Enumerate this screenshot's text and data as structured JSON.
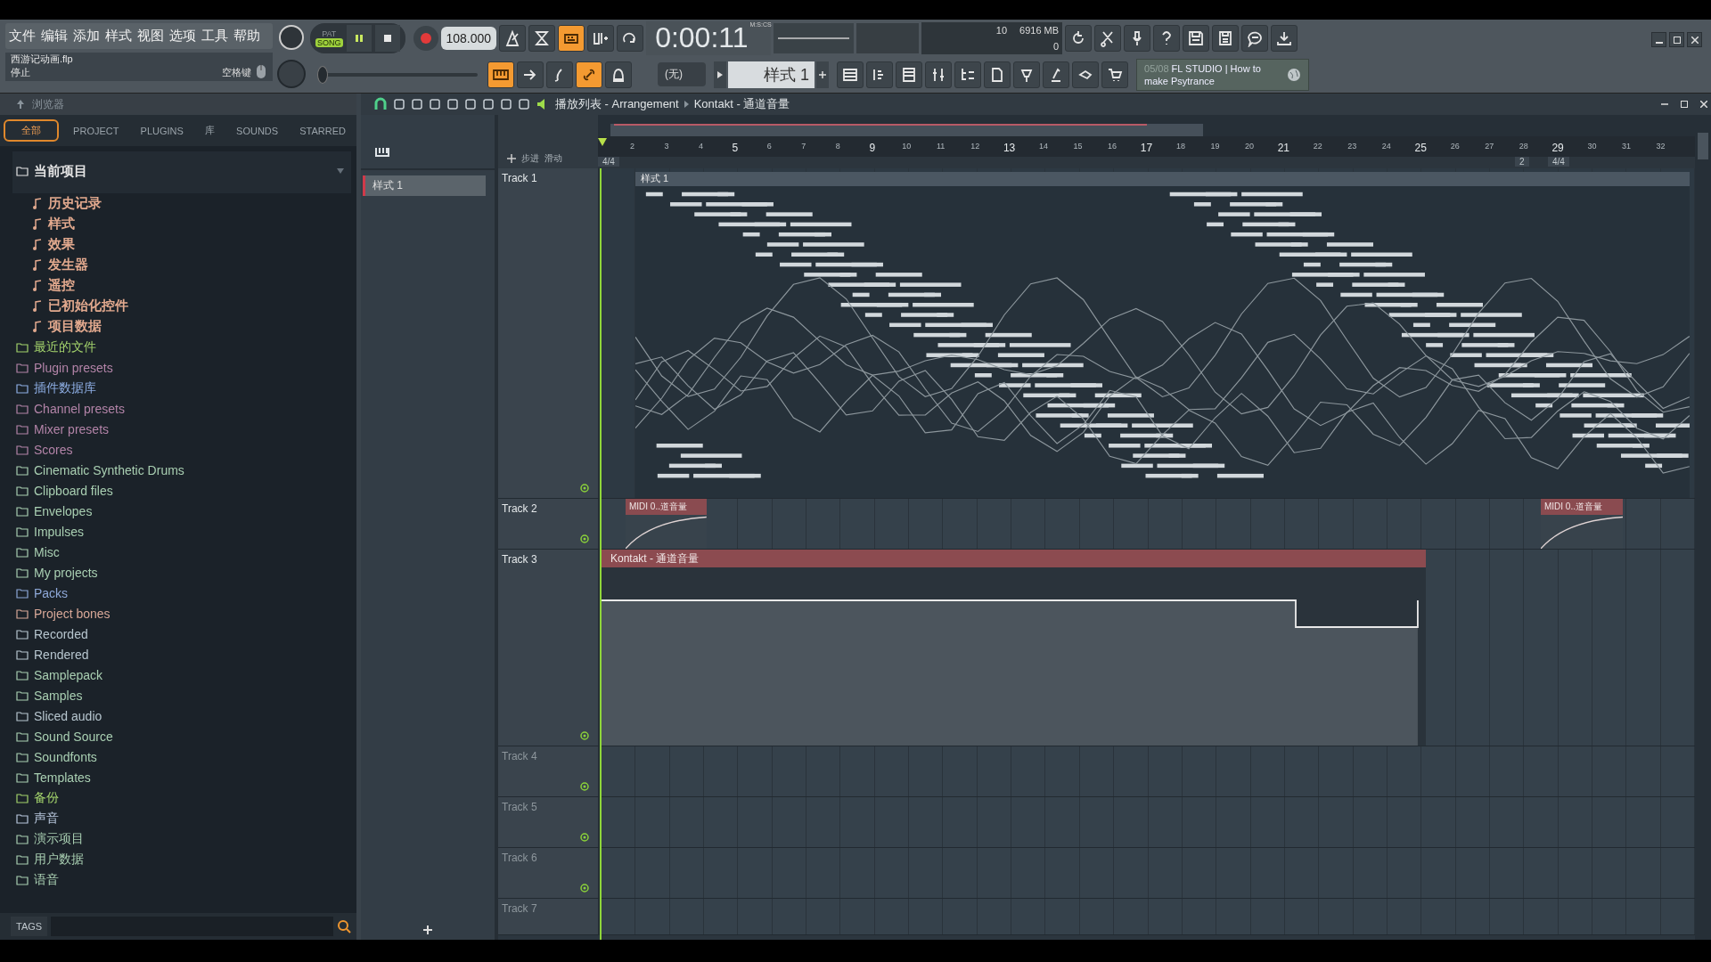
{
  "menu": [
    "文件",
    "编辑",
    "添加",
    "样式",
    "视图",
    "选项",
    "工具",
    "帮助"
  ],
  "project": {
    "file": "西游记动画.flp",
    "status": "停止",
    "hint": "空格键"
  },
  "pitch_slider": {
    "level": 0
  },
  "transport": {
    "modes": [
      {
        "label": "PAT",
        "selected": false
      },
      {
        "label": "SONG",
        "selected": true
      }
    ],
    "tempo": "108.000",
    "time": "0:00:11",
    "time_unit": "M:S:CS"
  },
  "toggles": [
    {
      "on": false
    },
    {
      "on": false
    },
    {
      "on": true
    },
    {
      "on": false
    },
    {
      "on": false
    }
  ],
  "toggles_row2": [
    {
      "on": true
    },
    {
      "on": false
    },
    {
      "on": false
    },
    {
      "on": true
    },
    {
      "on": false
    }
  ],
  "monitor": {
    "cpu": "10",
    "memory": "6916 MB",
    "polyphony": "0"
  },
  "pattern": {
    "channel_target": "(无)",
    "name": "样式 1"
  },
  "news": {
    "date": "05/08",
    "headline": "FL STUDIO | How to make Psytrance"
  },
  "browser": {
    "title": "浏览器",
    "tabs": [
      {
        "label": "全部",
        "selected": true
      },
      {
        "label": "PROJECT",
        "selected": false
      },
      {
        "label": "PLUGINS",
        "selected": false
      },
      {
        "label": "库",
        "selected": false
      },
      {
        "label": "SOUNDS",
        "selected": false
      },
      {
        "label": "STARRED",
        "selected": false
      }
    ],
    "tree": [
      {
        "label": "当前项目",
        "color": "#e4e4e4",
        "expanded": true,
        "children": [
          {
            "label": "历史记录",
            "color": "#e2a98e"
          },
          {
            "label": "样式",
            "color": "#e2a98e"
          },
          {
            "label": "效果",
            "color": "#e2a98e"
          },
          {
            "label": "发生器",
            "color": "#e2a98e"
          },
          {
            "label": "遥控",
            "color": "#e2a98e"
          },
          {
            "label": "已初始化控件",
            "color": "#e2a98e"
          },
          {
            "label": "项目数据",
            "color": "#e2a98e"
          }
        ]
      },
      {
        "label": "最近的文件",
        "color": "#a3d36c"
      },
      {
        "label": "Plugin presets",
        "color": "#b384a8"
      },
      {
        "label": "插件数据库",
        "color": "#8eaee4"
      },
      {
        "label": "Channel presets",
        "color": "#b384a8"
      },
      {
        "label": "Mixer presets",
        "color": "#b384a8"
      },
      {
        "label": "Scores",
        "color": "#b384a8"
      },
      {
        "label": "Cinematic Synthetic Drums",
        "color": "#a9cfb2"
      },
      {
        "label": "Clipboard files",
        "color": "#a9cfb2"
      },
      {
        "label": "Envelopes",
        "color": "#a9cfb2"
      },
      {
        "label": "Impulses",
        "color": "#a9cfb2"
      },
      {
        "label": "Misc",
        "color": "#a9cfb2"
      },
      {
        "label": "My projects",
        "color": "#a9cfb2"
      },
      {
        "label": "Packs",
        "color": "#8ea8d8"
      },
      {
        "label": "Project bones",
        "color": "#d8a898"
      },
      {
        "label": "Recorded",
        "color": "#b7c6cf"
      },
      {
        "label": "Rendered",
        "color": "#b7c6cf"
      },
      {
        "label": "Samplepack",
        "color": "#a9cfb2"
      },
      {
        "label": "Samples",
        "color": "#a9cfb2"
      },
      {
        "label": "Sliced audio",
        "color": "#b7c6cf"
      },
      {
        "label": "Sound Source",
        "color": "#a9cfb2"
      },
      {
        "label": "Soundfonts",
        "color": "#a9cfb2"
      },
      {
        "label": "Templates",
        "color": "#a9cfb2"
      },
      {
        "label": "备份",
        "color": "#a3d36c"
      },
      {
        "label": "声音",
        "color": "#b7c6dc"
      },
      {
        "label": "演示项目",
        "color": "#a9cfb2"
      },
      {
        "label": "用户数据",
        "color": "#a9cfb2"
      },
      {
        "label": "语音",
        "color": "#a9cfb2"
      }
    ],
    "tags_label": "TAGS"
  },
  "pattern_list": [
    {
      "name": "样式 1",
      "selected": true
    }
  ],
  "playlist": {
    "breadcrumb": [
      "播放列表 - Arrangement",
      "Kontakt - 通道音量"
    ],
    "step_label": "步进",
    "slide_label": "滑动",
    "bars": [
      "2",
      "3",
      "4",
      "5",
      "6",
      "7",
      "8",
      "9",
      "10",
      "11",
      "12",
      "13",
      "14",
      "15",
      "16",
      "17",
      "18",
      "19",
      "20",
      "21",
      "22",
      "23",
      "24",
      "25",
      "26",
      "27",
      "28",
      "29",
      "30",
      "31",
      "32"
    ],
    "time_signatures": [
      "4/4",
      "2",
      "4/4"
    ],
    "tracks": [
      {
        "name": "Track 1",
        "clips": [
          {
            "kind": "pattern",
            "label": "样式 1"
          }
        ]
      },
      {
        "name": "Track 2",
        "clips": [
          {
            "kind": "automation",
            "label": "MIDI 0..道音量"
          },
          {
            "kind": "automation",
            "label": "MIDI 0..道音量"
          }
        ]
      },
      {
        "name": "Track 3",
        "clips": [
          {
            "kind": "automation_long",
            "label": "Kontakt - 通道音量"
          }
        ]
      },
      {
        "name": "Track 4"
      },
      {
        "name": "Track 5"
      },
      {
        "name": "Track 6"
      },
      {
        "name": "Track 7"
      }
    ]
  }
}
